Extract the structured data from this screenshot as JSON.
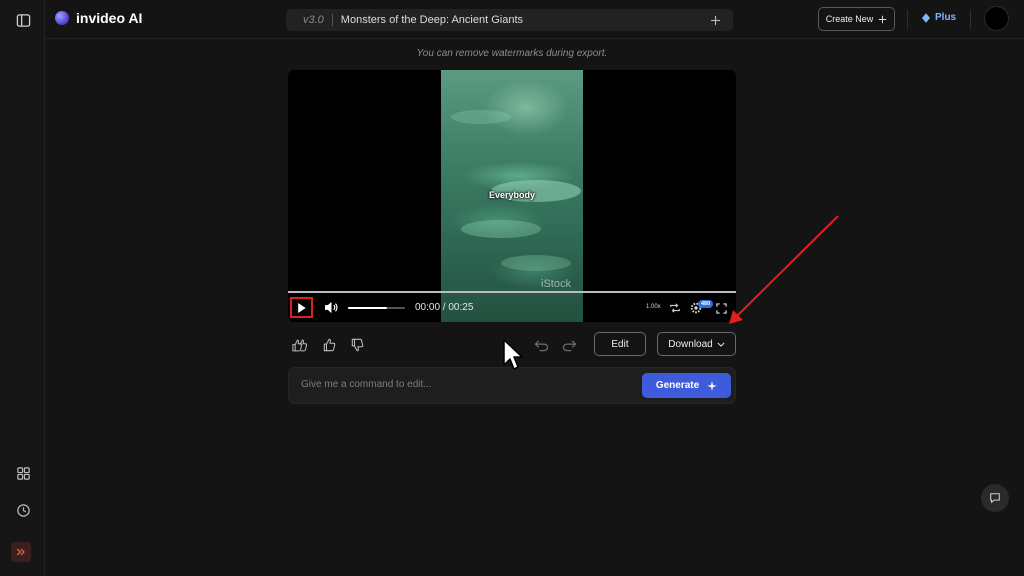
{
  "app": {
    "name": "invideo AI",
    "logo_icon": "invideo-orb-logo"
  },
  "header": {
    "version": "v3.0",
    "project_title": "Monsters of the Deep: Ancient Giants",
    "create_new_label": "Create New",
    "plan_label": "Plus",
    "accent_color": "#7fb6ff"
  },
  "sidebar": {
    "top_icon": "sidebar-toggle-icon",
    "items": [
      {
        "icon": "grid-icon"
      },
      {
        "icon": "history-clock-icon"
      }
    ],
    "expand_icon": "double-chevron-right-icon"
  },
  "notice": "You can remove watermarks during export.",
  "player": {
    "caption": "Everybody",
    "watermark": "iStock",
    "time_display": "00:00 / 00:25",
    "speed": "1.00x",
    "quality": "480",
    "volume_fraction": 0.68,
    "progress_fraction": 0.0,
    "highlight_color": "#e0201d"
  },
  "actions": {
    "edit_label": "Edit",
    "download_label": "Download"
  },
  "command": {
    "placeholder": "Give me a command to edit...",
    "value": "",
    "generate_label": "Generate",
    "button_color": "#3e5bdb"
  },
  "annotation": {
    "arrow_color": "#e0201d"
  }
}
